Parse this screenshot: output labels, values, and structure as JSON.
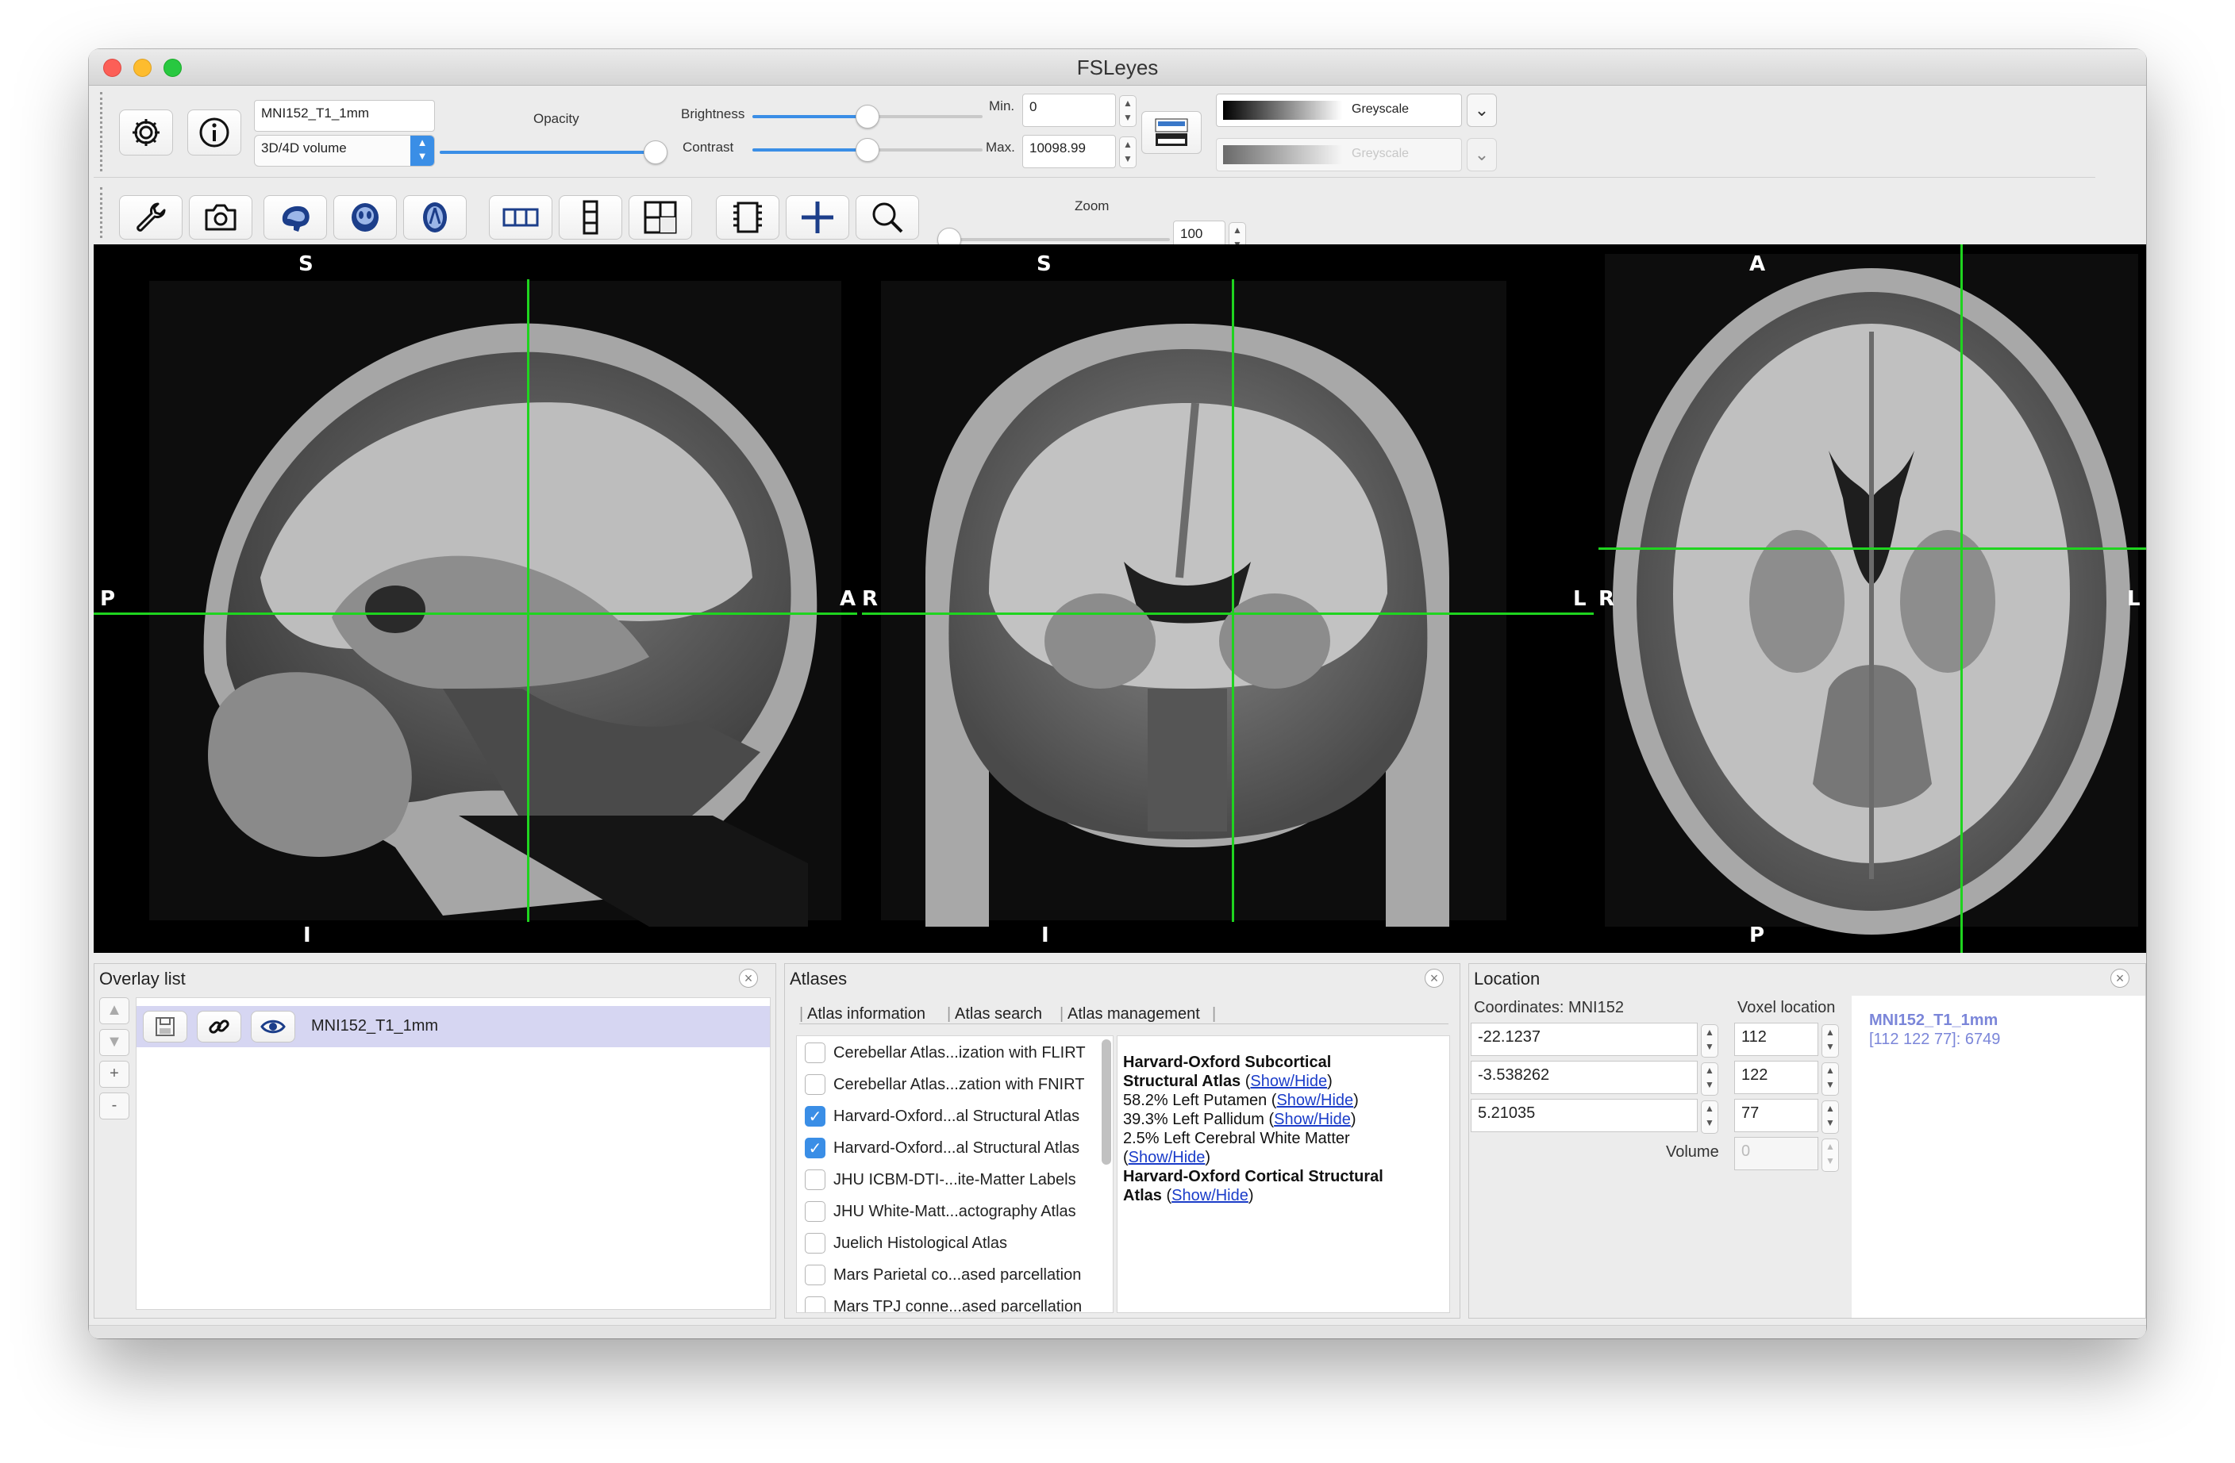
{
  "window": {
    "title": "FSLeyes"
  },
  "overlay_toolbar": {
    "overlay_name": "MNI152_T1_1mm",
    "overlay_type": "3D/4D volume",
    "opacity_label": "Opacity",
    "opacity_level": 1.0,
    "brightness_label": "Brightness",
    "brightness_level": 0.5,
    "contrast_label": "Contrast",
    "contrast_level": 0.5,
    "min_label": "Min.",
    "min_value": "0",
    "max_label": "Max.",
    "max_value": "10098.99",
    "colormap": "Greyscale",
    "neg_colormap": "Greyscale",
    "icons": [
      "gear-icon",
      "info-icon",
      "invert-colormap-icon"
    ]
  },
  "ortho_toolbar": {
    "zoom_label": "Zoom",
    "zoom_value": "100",
    "zoom_level": 0.0,
    "icons": [
      "wrench-icon",
      "camera-icon",
      "sagittal-icon",
      "coronal-icon",
      "axial-icon",
      "horizontal-layout-icon",
      "vertical-layout-icon",
      "grid-layout-icon",
      "movie-icon",
      "crosshair-icon",
      "zoom-icon"
    ]
  },
  "views": {
    "sagittal": {
      "top": "S",
      "bottom": "I",
      "left": "P",
      "right": "A"
    },
    "coronal": {
      "top": "S",
      "bottom": "I",
      "left": "R",
      "right": "L"
    },
    "axial": {
      "top": "A",
      "bottom": "P",
      "left": "R",
      "right": "L"
    }
  },
  "crosshair_color": "#1fd41f",
  "overlay_list": {
    "title": "Overlay list",
    "items": [
      {
        "name": "MNI152_T1_1mm",
        "visible": true
      }
    ],
    "buttons": {
      "up": "▲",
      "down": "▼",
      "add": "+",
      "remove": "-"
    }
  },
  "atlases": {
    "title": "Atlases",
    "tabs": [
      "Atlas information",
      "Atlas search",
      "Atlas management"
    ],
    "list": [
      {
        "label": "Cerebellar Atlas...ization with FLIRT",
        "checked": false
      },
      {
        "label": "Cerebellar Atlas...zation with FNIRT",
        "checked": false
      },
      {
        "label": "Harvard-Oxford...al Structural Atlas",
        "checked": true
      },
      {
        "label": "Harvard-Oxford...al Structural Atlas",
        "checked": true
      },
      {
        "label": "JHU ICBM-DTI-...ite-Matter Labels",
        "checked": false
      },
      {
        "label": "JHU White-Matt...actography Atlas",
        "checked": false
      },
      {
        "label": "Juelich Histological Atlas",
        "checked": false
      },
      {
        "label": "Mars Parietal co...ased parcellation",
        "checked": false
      },
      {
        "label": "Mars TPJ conne...ased parcellation",
        "checked": false
      }
    ],
    "info": {
      "subcortical_title_1": "Harvard-Oxford Subcortical",
      "subcortical_title_2": "Structural Atlas",
      "show_hide": "Show/Hide",
      "entries": [
        {
          "text": "58.2% Left Putamen"
        },
        {
          "text": "39.3% Left Pallidum"
        },
        {
          "text": "2.5% Left Cerebral White Matter"
        }
      ],
      "cortical_title_1": "Harvard-Oxford Cortical Structural",
      "cortical_title_2": "Atlas"
    }
  },
  "location": {
    "title": "Location",
    "coords_label": "Coordinates: MNI152",
    "voxel_label": "Voxel location",
    "coords": [
      "-22.1237",
      "-3.538262",
      "5.21035"
    ],
    "voxels": [
      "112",
      "122",
      "77"
    ],
    "volume_label": "Volume",
    "volume_value": "0",
    "info_name": "MNI152_T1_1mm",
    "info_value": "[112 122 77]: 6749",
    "info_color": "#7b86d9"
  }
}
